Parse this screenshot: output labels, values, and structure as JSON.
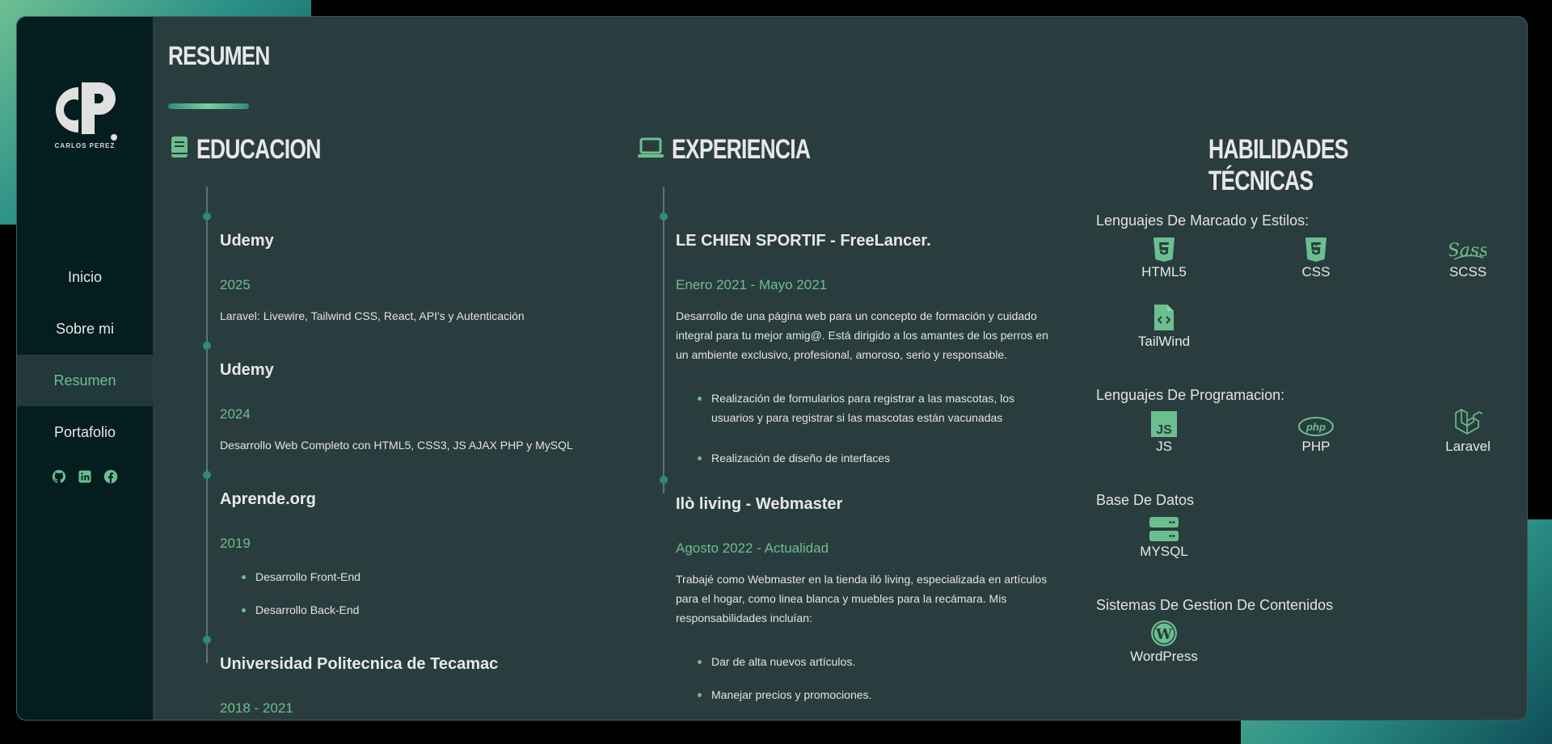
{
  "colors": {
    "accent": "#6bbf8f",
    "panel": "#2a3d3e",
    "sidebar": "#041d1f"
  },
  "sidebar": {
    "logo_text": "CARLOS PEREZ",
    "nav": [
      {
        "label": "Inicio"
      },
      {
        "label": "Sobre mi"
      },
      {
        "label": "Resumen"
      },
      {
        "label": "Portafolio"
      }
    ],
    "socials": [
      "github-icon",
      "linkedin-icon",
      "facebook-icon"
    ]
  },
  "page": {
    "title": "RESUMEN"
  },
  "education": {
    "heading": "EDUCACION",
    "icon": "book-icon",
    "entries": [
      {
        "institution": "Udemy",
        "date": "2025",
        "desc": "Laravel: Livewire, Tailwind CSS, React, API's y Autenticación"
      },
      {
        "institution": "Udemy",
        "date": "2024",
        "desc": "Desarrollo Web Completo con HTML5, CSS3, JS AJAX PHP y MySQL"
      },
      {
        "institution": "Aprende.org",
        "date": "2019",
        "bullets": [
          "Desarrollo Front-End",
          "Desarrollo Back-End"
        ]
      },
      {
        "institution": "Universidad Politecnica de Tecamac",
        "date": "2018 - 2021"
      }
    ]
  },
  "experience": {
    "heading": "EXPERIENCIA",
    "icon": "laptop-icon",
    "entries": [
      {
        "title": "LE CHIEN SPORTIF - FreeLancer.",
        "date": "Enero 2021 - Mayo 2021",
        "desc": [
          "Desarrollo de una página web para un concepto de formación y cuidado",
          "integral para tu mejor amig@. Está dirigido a los amantes de los perros en",
          "un ambiente exclusivo, profesional, amoroso, serio y responsable."
        ],
        "bullets": [
          [
            "Realización de formularios para registrar a las mascotas, los",
            "usuarios y para registrar si las mascotas están vacunadas"
          ],
          [
            "Realización de diseño de interfaces"
          ]
        ]
      },
      {
        "title": "Ilò living - Webmaster",
        "date": "Agosto 2022 - Actualidad",
        "desc": [
          "Trabajé como Webmaster en la tienda iló living, especializada en artículos",
          "para el hogar, como linea blanca y muebles para la recámara. Mis",
          "responsabilidades incluían:"
        ],
        "bullets": [
          [
            "Dar de alta nuevos artículos."
          ],
          [
            "Manejar precios y promociones."
          ]
        ]
      }
    ]
  },
  "skills": {
    "heading": "HABILIDADES TÉCNICAS",
    "categories": [
      {
        "name": "Lenguajes De Marcado y Estilos:",
        "items": [
          {
            "label": "HTML5",
            "icon": "html5-icon"
          },
          {
            "label": "CSS",
            "icon": "css3-icon"
          },
          {
            "label": "SCSS",
            "icon": "sass-icon"
          },
          {
            "label": "TailWind",
            "icon": "code-file-icon"
          }
        ]
      },
      {
        "name": "Lenguajes De Programacion:",
        "items": [
          {
            "label": "JS",
            "icon": "js-icon"
          },
          {
            "label": "PHP",
            "icon": "php-icon"
          },
          {
            "label": "Laravel",
            "icon": "laravel-icon"
          }
        ]
      },
      {
        "name": "Base De Datos",
        "items": [
          {
            "label": "MYSQL",
            "icon": "database-server-icon"
          }
        ]
      },
      {
        "name": "Sistemas De Gestion De Contenidos",
        "items": [
          {
            "label": "WordPress",
            "icon": "wordpress-icon"
          }
        ]
      }
    ]
  }
}
